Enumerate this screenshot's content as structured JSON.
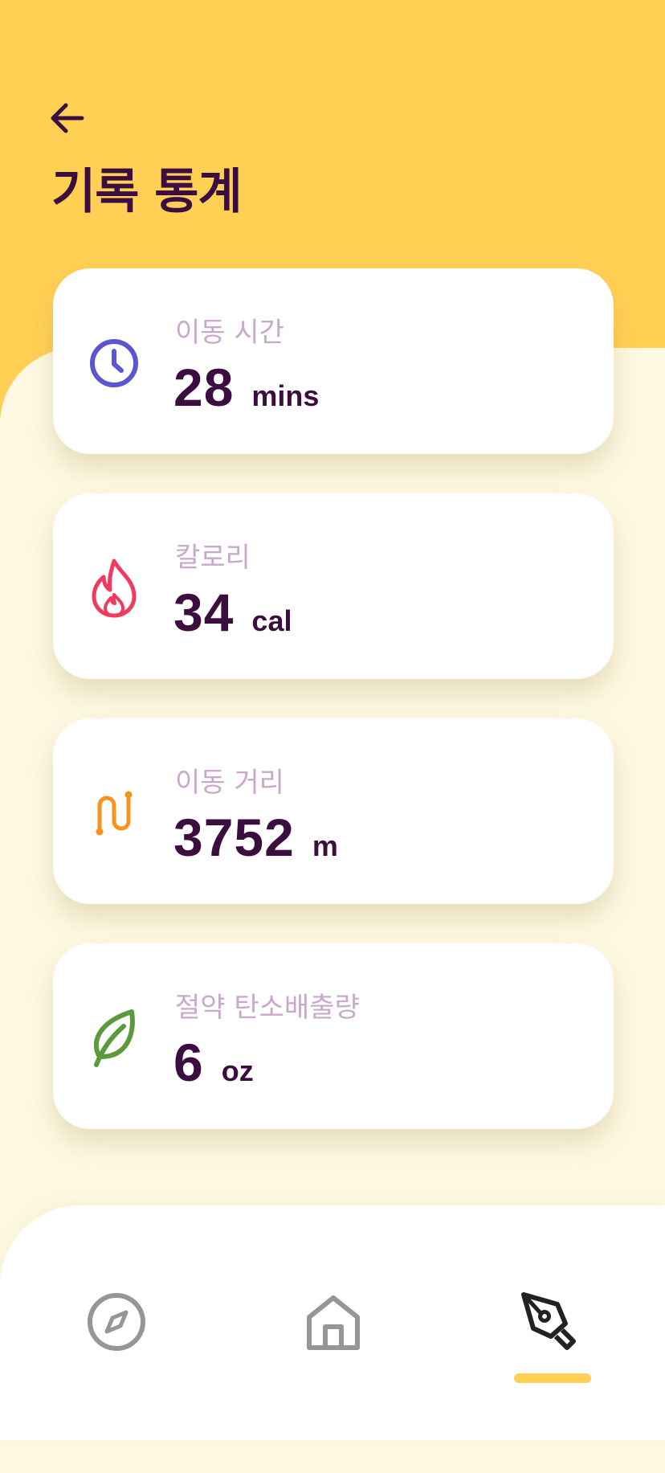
{
  "header": {
    "title": "기록 통계",
    "back_icon": "arrow-left-icon"
  },
  "stats": [
    {
      "label": "이동 시간",
      "value": "28",
      "unit": "mins",
      "icon": "clock-icon",
      "color": "#5B55D0"
    },
    {
      "label": "칼로리",
      "value": "34",
      "unit": "cal",
      "icon": "flame-icon",
      "color": "#F03A5F"
    },
    {
      "label": "이동 거리",
      "value": "3752",
      "unit": "m",
      "icon": "route-icon",
      "color": "#F7941D"
    },
    {
      "label": "절약 탄소배출량",
      "value": "6",
      "unit": "oz",
      "icon": "leaf-icon",
      "color": "#5B9A3A"
    }
  ],
  "bottom_nav": {
    "items": [
      {
        "icon": "compass-icon",
        "active": false
      },
      {
        "icon": "home-icon",
        "active": false
      },
      {
        "icon": "pen-nib-icon",
        "active": true
      }
    ],
    "accent": "#FFD054"
  },
  "colors": {
    "header_bg": "#FFD054",
    "page_bg": "#FDF8E1",
    "title_text": "#3B0E3F",
    "label_text": "#C9A9CB"
  }
}
